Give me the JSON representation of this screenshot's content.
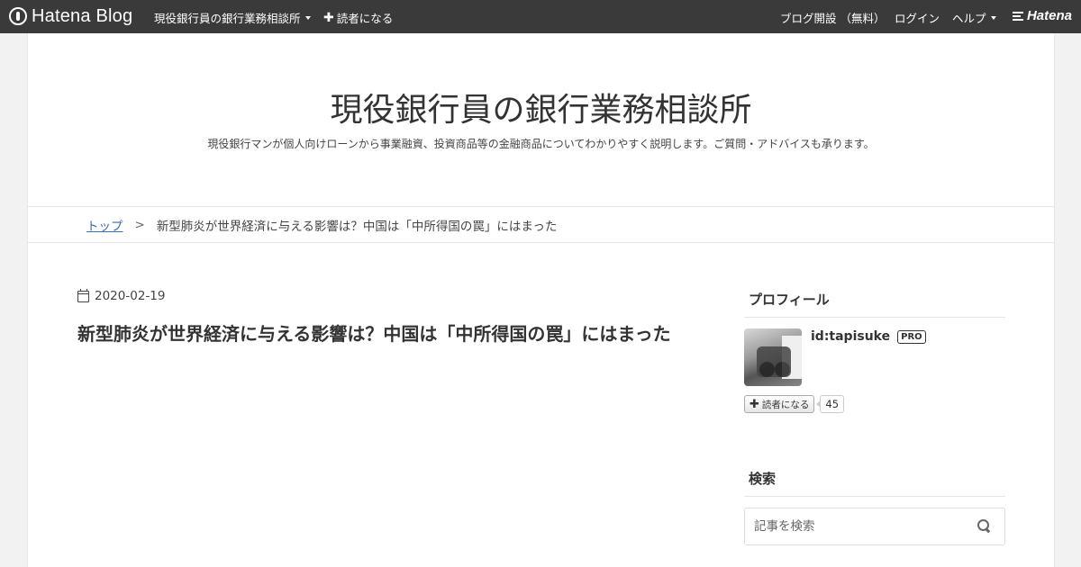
{
  "topbar": {
    "logo_text": "Hatena Blog",
    "blog_menu_label": "現役銀行員の銀行業務相談所",
    "subscribe_label": "読者になる",
    "open_blog_label": "ブログ開設 （無料）",
    "login_label": "ログイン",
    "help_label": "ヘルプ",
    "brand_text": "Hatena"
  },
  "header": {
    "title": "現役銀行員の銀行業務相談所",
    "description": "現役銀行マンが個人向けローンから事業融資、投資商品等の金融商品についてわかりやすく説明します。ご質問・アドバイスも承ります。"
  },
  "breadcrumb": {
    "home_label": "トップ",
    "separator": ">",
    "current": "新型肺炎が世界経済に与える影響は？中国は「中所得国の罠」にはまった"
  },
  "article": {
    "date": "2020-02-19",
    "title": "新型肺炎が世界経済に与える影響は？中国は「中所得国の罠」にはまった"
  },
  "sidebar": {
    "profile_heading": "プロフィール",
    "profile_id": "id:tapisuke",
    "pro_badge": "PRO",
    "subscribe_label": "読者になる",
    "subscriber_count": "45",
    "search_heading": "検索",
    "search_placeholder": "記事を検索"
  }
}
